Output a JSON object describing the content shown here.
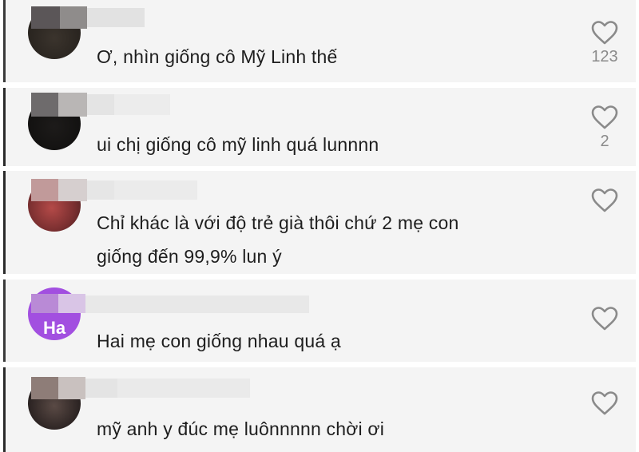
{
  "comments": [
    {
      "text": "Ơ, nhìn giống cô Mỹ Linh thế",
      "likes": "123"
    },
    {
      "text": "ui chị giống cô mỹ linh quá lunnnn",
      "likes": "2"
    },
    {
      "lines": [
        "Chỉ khác là với độ trẻ già thôi chứ 2 mẹ con",
        "giống đến 99,9% lun ý"
      ],
      "likes": ""
    },
    {
      "text": "Hai mẹ con giống nhau quá ạ",
      "avatar_letters": "Ha",
      "likes": ""
    },
    {
      "text": "mỹ anh y đúc mẹ luônnnnn chời ơi",
      "likes": ""
    }
  ],
  "icons": {
    "like": "heart-outline-icon"
  },
  "colors": {
    "card_bg": "#f4f4f4",
    "text": "#1e1e1e",
    "count": "#8a8a8a",
    "avatar_purple": "#a24fe0",
    "heart": "#8a8a8a"
  }
}
